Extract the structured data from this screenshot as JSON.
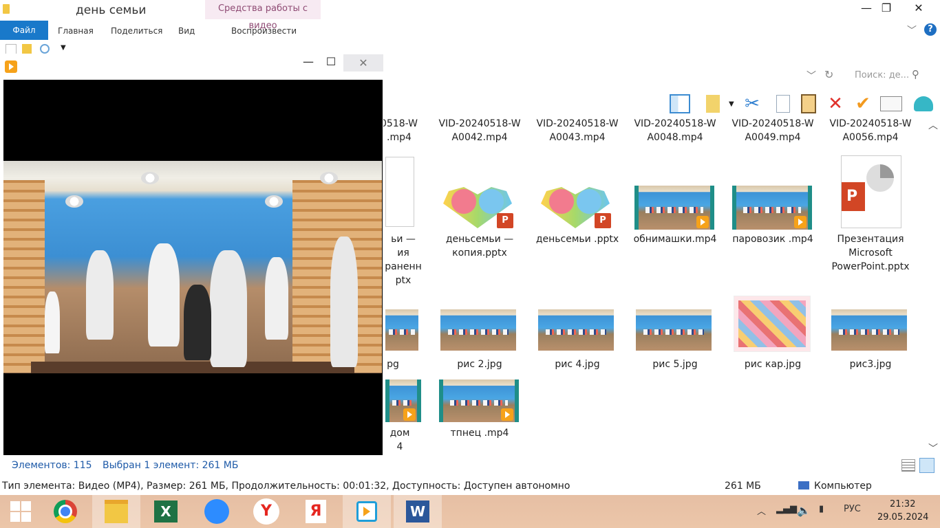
{
  "window": {
    "title": "день семьи",
    "context_tab": "Средства работы с видео",
    "minimize": "—",
    "maximize": "❐",
    "close": "✕"
  },
  "ribbon": {
    "tabs": [
      "Файл",
      "Главная",
      "Поделиться",
      "Вид",
      "Воспроизвести"
    ],
    "help": "?"
  },
  "search": {
    "placeholder": "Поиск: де..."
  },
  "files": {
    "row1": [
      {
        "name": "VID-20240518-W\nA0042.mp4"
      },
      {
        "name": "VID-20240518-W\nA0043.mp4"
      },
      {
        "name": "VID-20240518-W\nA0048.mp4"
      },
      {
        "name": "VID-20240518-W\nA0049.mp4"
      },
      {
        "name": "VID-20240518-W\nA0056.mp4"
      }
    ],
    "row1_partial": "0518-W\n.mp4",
    "row2_partial": "ьи  —\nия\nраненн\nptx",
    "row2": [
      {
        "name": "деньсемьи  —\nкопия.pptx"
      },
      {
        "name": "деньсемьи .pptx"
      },
      {
        "name": "обнимашки.mp4"
      },
      {
        "name": "паровозик .mp4"
      },
      {
        "name": "Презентация\nMicrosoft\nPowerPoint.pptx"
      }
    ],
    "row3_partial": "pg",
    "row3": [
      {
        "name": "рис 2.jpg"
      },
      {
        "name": "рис 4.jpg"
      },
      {
        "name": "рис 5.jpg"
      },
      {
        "name": "рис кар.jpg"
      },
      {
        "name": "рис3.jpg"
      }
    ],
    "row4_partial": "дом\n4",
    "row4": [
      {
        "name": "тпнец .mp4"
      }
    ]
  },
  "status": {
    "count": "Элементов: 115",
    "selected": "Выбран 1 элемент: 261 МБ",
    "details": "Тип элемента: Видео (MP4), Размер: 261 МБ, Продолжительность: 00:01:32, Доступность: Доступен автономно",
    "size": "261 МБ",
    "location": "Компьютер"
  },
  "player": {
    "minimize": "—",
    "maximize": "☐",
    "close": "✕"
  },
  "taskbar": {
    "apps": [
      "windows-start",
      "chrome",
      "file-explorer",
      "excel",
      "zoom",
      "yandex-browser",
      "yandex",
      "video-player",
      "word"
    ],
    "lang": "РУС",
    "time": "21:32",
    "date": "29.05.2024"
  },
  "colors": {
    "file_tab": "#1979ca",
    "context_tab_bg": "#f7eaf2",
    "status_text": "#1e5aa8",
    "taskbar": "#e9c3a7"
  }
}
